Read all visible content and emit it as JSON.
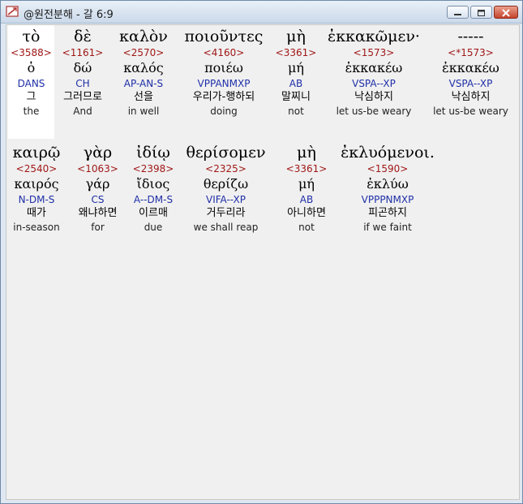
{
  "window": {
    "title": "@원전분해 - 갈 6:9"
  },
  "rows": [
    {
      "words": [
        {
          "greek": "τὸ",
          "strongs": "<3588>",
          "lexeme": "ὁ",
          "parsing": "DANS",
          "korean": "그",
          "english": "the"
        },
        {
          "greek": "δὲ",
          "strongs": "<1161>",
          "lexeme": "δώ",
          "parsing": "CH",
          "korean": "그러므로",
          "english": "And"
        },
        {
          "greek": "καλὸν",
          "strongs": "<2570>",
          "lexeme": "καλός",
          "parsing": "AP-AN-S",
          "korean": "선을",
          "english": "in well"
        },
        {
          "greek": "ποιοῦντες",
          "strongs": "<4160>",
          "lexeme": "ποιέω",
          "parsing": "VPPANMXP",
          "korean": "우리가-행하되",
          "english": "doing"
        },
        {
          "greek": "μὴ",
          "strongs": "<3361>",
          "lexeme": "μή",
          "parsing": "AB",
          "korean": "말찌니",
          "english": "not"
        },
        {
          "greek": "ἐκκακῶμεν·",
          "strongs": "<1573>",
          "lexeme": "ἐκκακέω",
          "parsing": "VSPA--XP",
          "korean": "낙심하지",
          "english": "let us-be weary"
        },
        {
          "greek": "-----",
          "strongs": "<*1573>",
          "lexeme": "ἐκκακέω",
          "parsing": "VSPA--XP",
          "korean": "낙심하지",
          "english": "let us-be weary"
        }
      ]
    },
    {
      "words": [
        {
          "greek": "καιρῷ",
          "strongs": "<2540>",
          "lexeme": "καιρός",
          "parsing": "N-DM-S",
          "korean": "때가",
          "english": "in-season"
        },
        {
          "greek": "γὰρ",
          "strongs": "<1063>",
          "lexeme": "γάρ",
          "parsing": "CS",
          "korean": "왜냐하면",
          "english": "for"
        },
        {
          "greek": "ἰδίῳ",
          "strongs": "<2398>",
          "lexeme": "ἴδιος",
          "parsing": "A--DM-S",
          "korean": "이르매",
          "english": "due"
        },
        {
          "greek": "θερίσομεν",
          "strongs": "<2325>",
          "lexeme": "θερίζω",
          "parsing": "VIFA--XP",
          "korean": "거두리라",
          "english": "we shall reap"
        },
        {
          "greek": "μὴ",
          "strongs": "<3361>",
          "lexeme": "μή",
          "parsing": "AB",
          "korean": "아니하면",
          "english": "not"
        },
        {
          "greek": "ἐκλυόμενοι.",
          "strongs": "<1590>",
          "lexeme": "ἐκλύω",
          "parsing": "VPPPNMXP",
          "korean": "피곤하지",
          "english": "if we faint"
        }
      ]
    }
  ]
}
